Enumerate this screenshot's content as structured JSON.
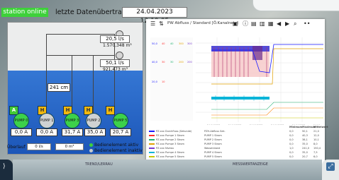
{
  "header": {
    "status_label": "station online",
    "last_transfer_label": "letzte Datenübertragung",
    "last_transfer_value": "24.04.2023 12:19:05"
  },
  "plant": {
    "flows": [
      {
        "value": "20,5 l/s",
        "total": "1.570,348 m³"
      },
      {
        "value": "50,1 l/s",
        "total": "921,473 m³"
      }
    ],
    "level": "241 cm",
    "markers": [
      "A",
      "H",
      "H",
      "H",
      "H"
    ],
    "pumps": [
      {
        "label": "PUMP 1",
        "current": "0,0 A",
        "state": "gray"
      },
      {
        "label": "PUMP 2",
        "current": "0,0 A",
        "state": "gray"
      },
      {
        "label": "PUMP 3",
        "current": "31,7 A",
        "state": "green"
      },
      {
        "label": "PUMP 4",
        "current": "35,0 A",
        "state": "green"
      },
      {
        "label": "PUMP 5",
        "current": "20,7 A",
        "state": "green"
      },
      {
        "label": "PUMP 0",
        "current": "0,0 A",
        "state": "green"
      }
    ],
    "overflow_label": "Überlauf",
    "overflow_value1": "0 l/s",
    "overflow_value2": "0 m³",
    "legend": [
      "Bedienelement aktiv",
      "Bedienelement inaktiv"
    ]
  },
  "viewer": {
    "title": "PW Abfluss / Standard [Ö.Kanalnetz]",
    "table_header": [
      "",
      "Minimum",
      "Maximum",
      "Mittelwert"
    ],
    "rows": [
      {
        "color": "#1a1aff",
        "name": "PZ.xxx Durchfluss (Sekunde)",
        "desc": "PZH-Abfluss Sek.",
        "v1": "0,0",
        "v2": "50,1",
        "v3": "21,0"
      },
      {
        "color": "#ff2d2d",
        "name": "PZ.xxx Pumpe 1 Strom",
        "desc": "PUMP 1 Strom",
        "v1": "0,0",
        "v2": "40,3",
        "v3": "12,0"
      },
      {
        "color": "#20b070",
        "name": "PZ.xxx Pumpe 2 Strom",
        "desc": "PUMP 2 Strom",
        "v1": "0,0",
        "v2": "38,1",
        "v3": "10,1"
      },
      {
        "color": "#e0a000",
        "name": "PZ.xxx Pumpe 3 Strom",
        "desc": "PUMP 3 Strom",
        "v1": "0,0",
        "v2": "35,0",
        "v3": "8,0"
      },
      {
        "color": "#7a3bd0",
        "name": "PZ.xxx Niveau",
        "desc": "Wasserstand",
        "v1": "1,0",
        "v2": "241,0",
        "v3": "150,4"
      },
      {
        "color": "#00b4d8",
        "name": "PZ.xxx Pumpe 4 Strom",
        "desc": "PUMP 4 Strom",
        "v1": "0,0",
        "v2": "35,0",
        "v3": "7,5"
      },
      {
        "color": "#c8c800",
        "name": "PZ.xxx Pumpe 5 Strom",
        "desc": "PUMP 5 Strom",
        "v1": "0,0",
        "v2": "20,7",
        "v3": "6,0"
      },
      {
        "color": "#ff7f00",
        "name": "PZ.xxx Überlauf",
        "desc": "Überlauf Summe",
        "v1": "0,0",
        "v2": "0,0",
        "v3": "0,0"
      }
    ],
    "footer": "Keine Änderungen vorhanden"
  },
  "bottom": {
    "left_label": "TREND/LERRAU",
    "right_label": "MESSWERTANZEIGE"
  }
}
